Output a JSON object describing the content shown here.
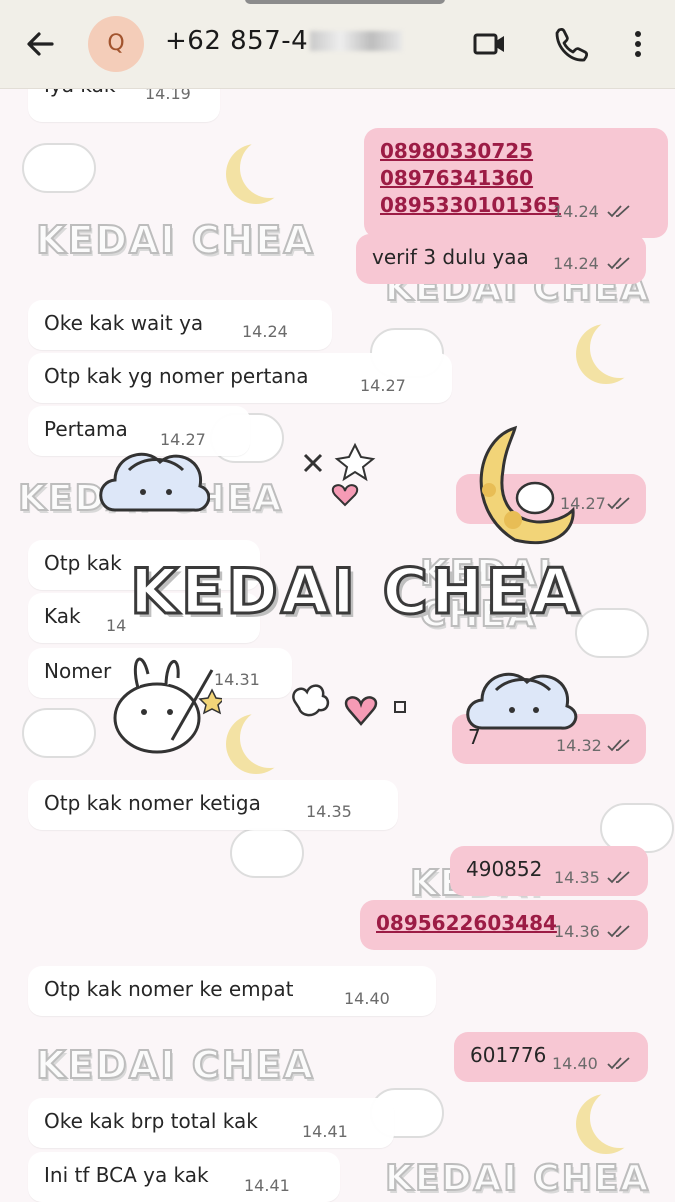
{
  "header": {
    "avatar_letter": "Q",
    "contact_visible": "+62 857-4",
    "icons": [
      "back-arrow-icon",
      "video-call-icon",
      "phone-icon",
      "more-vertical-icon"
    ]
  },
  "wallpaper": {
    "watermark": "KEDAI CHEA"
  },
  "messages": [
    {
      "text": "Iya kak",
      "time": "14.19"
    },
    {
      "lines": [
        "08980330725",
        "08976341360",
        "0895330101365"
      ],
      "time": "14.24"
    },
    {
      "text": "verif 3 dulu yaa",
      "time": "14.24"
    },
    {
      "text": "Oke kak wait ya",
      "time": "14.24"
    },
    {
      "text": "Otp kak yg nomer pertana",
      "time": "14.27"
    },
    {
      "text": "Pertama",
      "time": "14.27"
    },
    {
      "text": "",
      "time": "14.27"
    },
    {
      "text": "Otp kak",
      "time": ""
    },
    {
      "text": "Kak",
      "time": "14"
    },
    {
      "text": "Nomer",
      "time": "14.31"
    },
    {
      "text": "7",
      "time": "14.32"
    },
    {
      "text": "Otp kak nomer ketiga",
      "time": "14.35"
    },
    {
      "text": "490852",
      "time": "14.35"
    },
    {
      "text": "0895622603484",
      "time": "14.36"
    },
    {
      "text": "Otp kak nomer ke empat",
      "time": "14.40"
    },
    {
      "text": "601776",
      "time": "14.40"
    },
    {
      "text": "Oke kak brp total kak",
      "time": "14.41"
    },
    {
      "text": "Ini tf BCA ya kak",
      "time": "14.41"
    }
  ],
  "sticker": {
    "text": "KEDAI CHEA"
  },
  "colors": {
    "header_bg": "#f1efe8",
    "outgoing_bubble": "#f7c7d3",
    "incoming_bubble": "#ffffff",
    "link": "#9c1c45",
    "avatar_bg": "#f4cdb9"
  }
}
